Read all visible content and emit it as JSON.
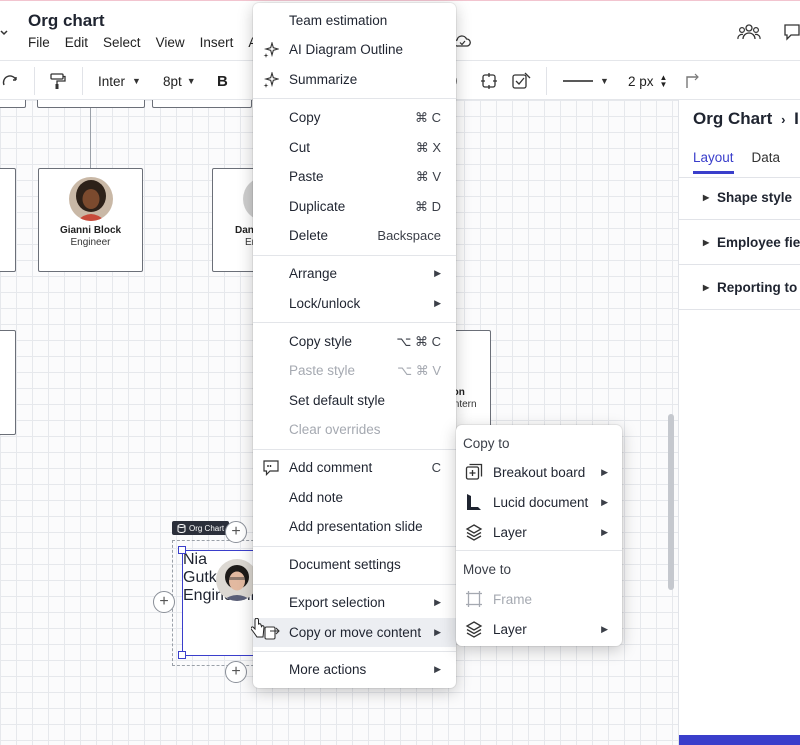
{
  "header": {
    "title": "Org chart",
    "menu": [
      "File",
      "Edit",
      "Select",
      "View",
      "Insert",
      "A"
    ]
  },
  "toolbar": {
    "font": "Inter",
    "font_size": "8pt",
    "bold": "B",
    "line_width": "2 px"
  },
  "canvas": {
    "cards": [
      {
        "name": "Gianni Block",
        "role": "Engineer"
      },
      {
        "name": "Dan",
        "role": "Er"
      },
      {
        "name": "ikton",
        "role": "Intern"
      }
    ],
    "selected_card": {
      "name": "Nia Gutkow",
      "role": "Engineering"
    },
    "tag_label": "Org Chart",
    "plus": "+"
  },
  "right_panel": {
    "title": "Org Chart",
    "breadcrumb_tail": "I",
    "tabs": [
      {
        "label": "Layout",
        "active": true
      },
      {
        "label": "Data",
        "active": false
      }
    ],
    "sections": [
      "Shape style",
      "Employee fiel",
      "Reporting to"
    ]
  },
  "context_menu": {
    "items": [
      {
        "label": "Team estimation",
        "shortcut": ""
      },
      {
        "label": "AI Diagram Outline",
        "shortcut": "",
        "icon": "sparkle-icon"
      },
      {
        "label": "Summarize",
        "shortcut": "",
        "icon": "sparkle-icon"
      },
      {
        "label": "Copy",
        "shortcut": "⌘ C"
      },
      {
        "label": "Cut",
        "shortcut": "⌘ X"
      },
      {
        "label": "Paste",
        "shortcut": "⌘ V"
      },
      {
        "label": "Duplicate",
        "shortcut": "⌘ D"
      },
      {
        "label": "Delete",
        "shortcut": "Backspace"
      },
      {
        "label": "Arrange",
        "submenu": true
      },
      {
        "label": "Lock/unlock",
        "submenu": true
      },
      {
        "label": "Copy style",
        "shortcut": "⌥ ⌘ C"
      },
      {
        "label": "Paste style",
        "shortcut": "⌥ ⌘ V",
        "disabled": true
      },
      {
        "label": "Set default style",
        "shortcut": ""
      },
      {
        "label": "Clear overrides",
        "shortcut": "",
        "disabled": true
      },
      {
        "label": "Add comment",
        "shortcut": "C",
        "icon": "comment-icon"
      },
      {
        "label": "Add note",
        "shortcut": ""
      },
      {
        "label": "Add presentation slide",
        "shortcut": ""
      },
      {
        "label": "Document settings",
        "shortcut": ""
      },
      {
        "label": "Export selection",
        "submenu": true
      },
      {
        "label": "Copy or move content",
        "submenu": true,
        "highlighted": true
      },
      {
        "label": "More actions",
        "submenu": true
      }
    ]
  },
  "submenu": {
    "copy_to_header": "Copy to",
    "copy_items": [
      {
        "label": "Breakout board",
        "icon": "breakout-board-icon"
      },
      {
        "label": "Lucid document",
        "icon": "lucid-document-icon"
      },
      {
        "label": "Layer",
        "icon": "layers-icon"
      }
    ],
    "move_to_header": "Move to",
    "move_items": [
      {
        "label": "Frame",
        "icon": "frame-icon",
        "disabled": true
      },
      {
        "label": "Layer",
        "icon": "layers-icon"
      }
    ]
  },
  "colors": {
    "accent": "#3a3ecb",
    "menu_hover": "#eceef2",
    "disabled_text": "#a5a9b1"
  }
}
